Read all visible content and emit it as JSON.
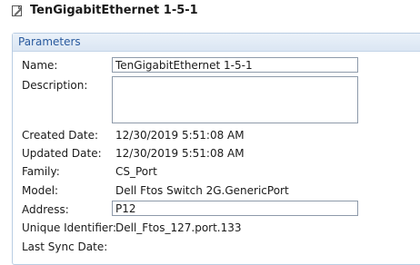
{
  "window": {
    "title": "TenGigabitEthernet 1-5-1",
    "icon": "document-icon"
  },
  "parameters": {
    "header": "Parameters",
    "name_label": "Name:",
    "name_value": "TenGigabitEthernet 1-5-1",
    "description_label": "Description:",
    "description_value": "",
    "created_label": "Created Date:",
    "created_value": "12/30/2019 5:51:08 AM",
    "updated_label": "Updated Date:",
    "updated_value": "12/30/2019 5:51:08 AM",
    "family_label": "Family:",
    "family_value": "CS_Port",
    "model_label": "Model:",
    "model_value": "Dell Ftos Switch 2G.GenericPort",
    "address_label": "Address:",
    "address_value": "P12",
    "uid_label": "Unique Identifier:",
    "uid_value": "Dell_Ftos_127.port.133",
    "lastsync_label": "Last Sync Date:",
    "lastsync_value": ""
  }
}
